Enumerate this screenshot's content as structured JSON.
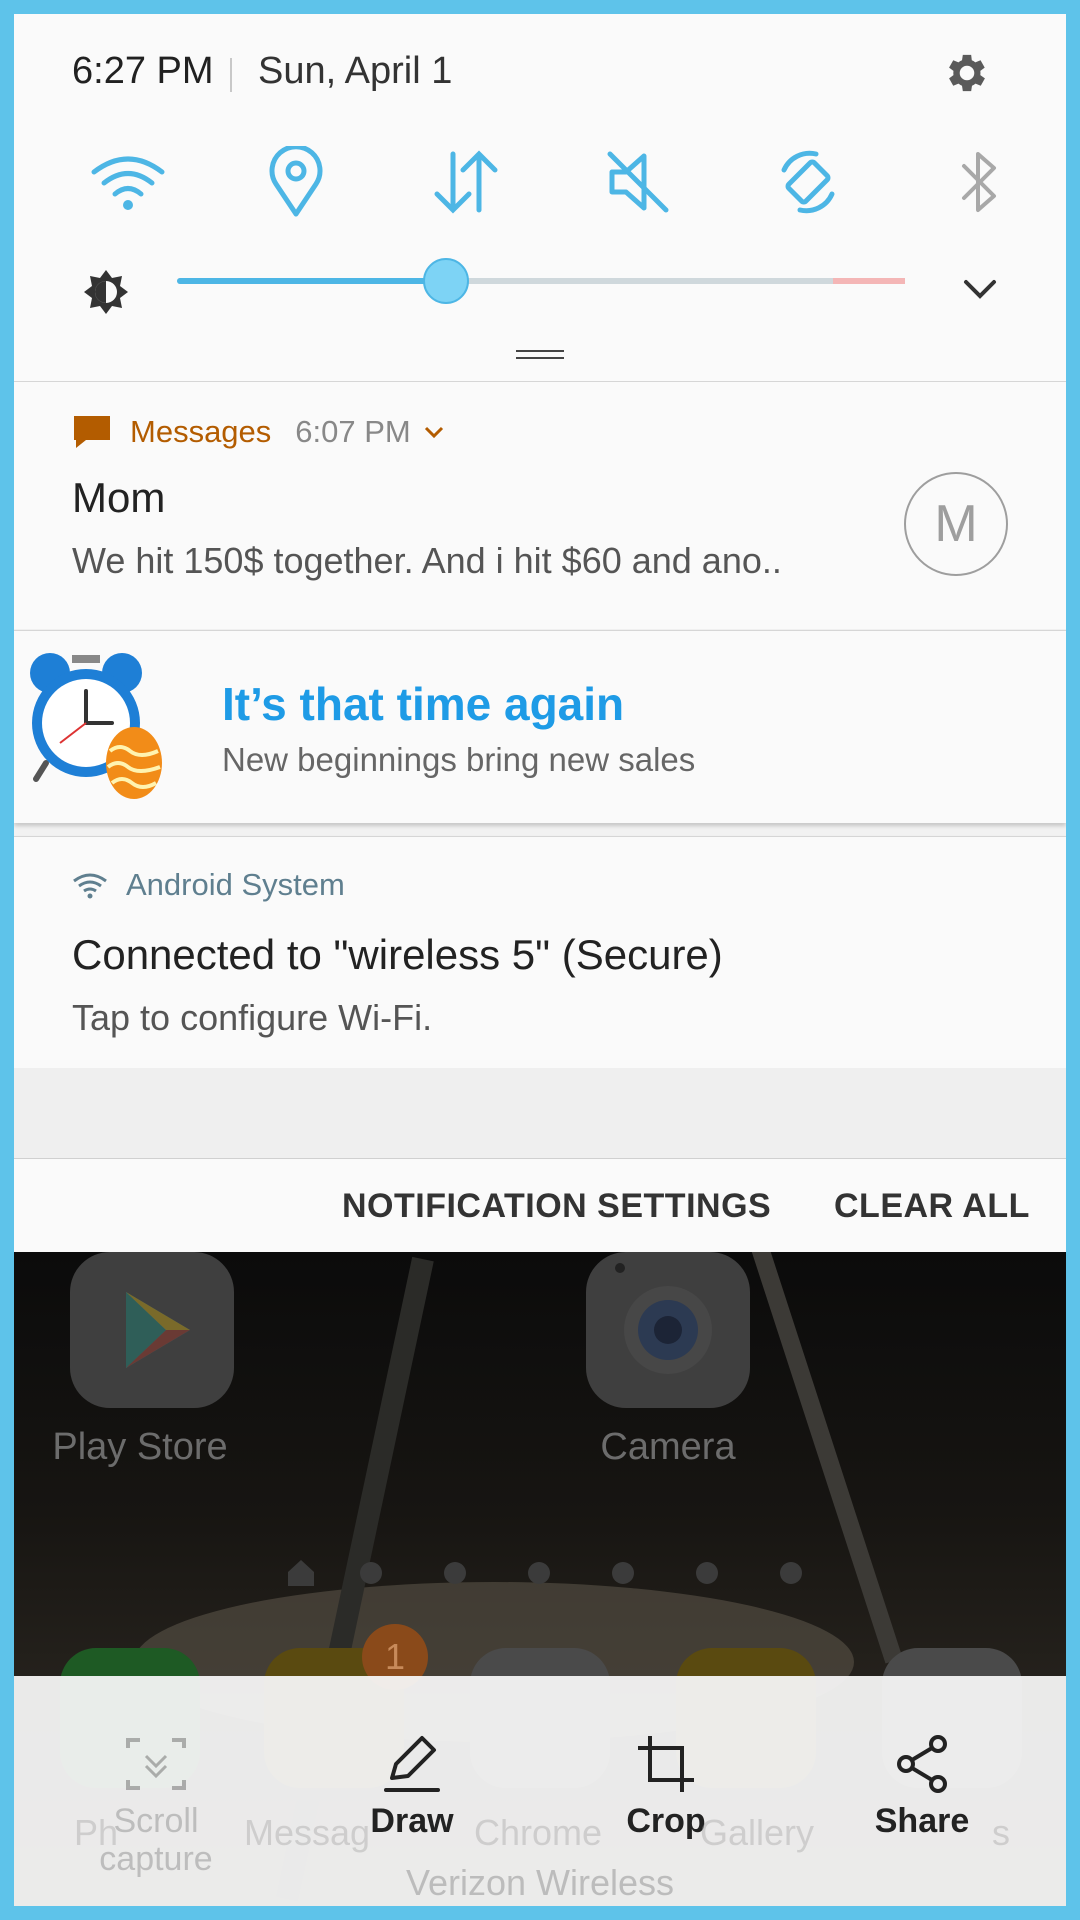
{
  "status": {
    "time": "6:27 PM",
    "date": "Sun, April 1"
  },
  "quick_settings": {
    "toggles": [
      {
        "name": "wifi-icon",
        "active": true
      },
      {
        "name": "location-icon",
        "active": true
      },
      {
        "name": "mobile-data-icon",
        "active": true
      },
      {
        "name": "sound-muted-icon",
        "active": true
      },
      {
        "name": "auto-rotate-icon",
        "active": true
      },
      {
        "name": "bluetooth-icon",
        "active": false
      }
    ],
    "brightness_level": 0.37
  },
  "notifications": {
    "messages": {
      "app": "Messages",
      "time": "6:07 PM",
      "title": "Mom",
      "text": "We hit 150$ together. And i hit $60 and ano..",
      "avatar_letter": "M"
    },
    "promo": {
      "title": "It’s that time again",
      "text": "New beginnings bring new sales"
    },
    "system": {
      "app": "Android System",
      "title": "Connected to \"wireless 5\" (Secure)",
      "text": "Tap to configure Wi-Fi."
    }
  },
  "footer": {
    "settings_label": "NOTIFICATION SETTINGS",
    "clear_label": "CLEAR ALL"
  },
  "home": {
    "apps": [
      {
        "label": "Play Store"
      },
      {
        "label": "Camera"
      }
    ],
    "dock_labels": [
      "Ph",
      "Messag",
      "Chrome",
      "Gallery",
      "s"
    ],
    "badge": "1",
    "carrier": "Verizon Wireless"
  },
  "toolbar": {
    "scroll_label_1": "Scroll",
    "scroll_label_2": "capture",
    "draw_label": "Draw",
    "crop_label": "Crop",
    "share_label": "Share"
  },
  "colors": {
    "accent": "#4db6e5",
    "messages_app": "#b35c00",
    "promo_title": "#1e9be6"
  }
}
